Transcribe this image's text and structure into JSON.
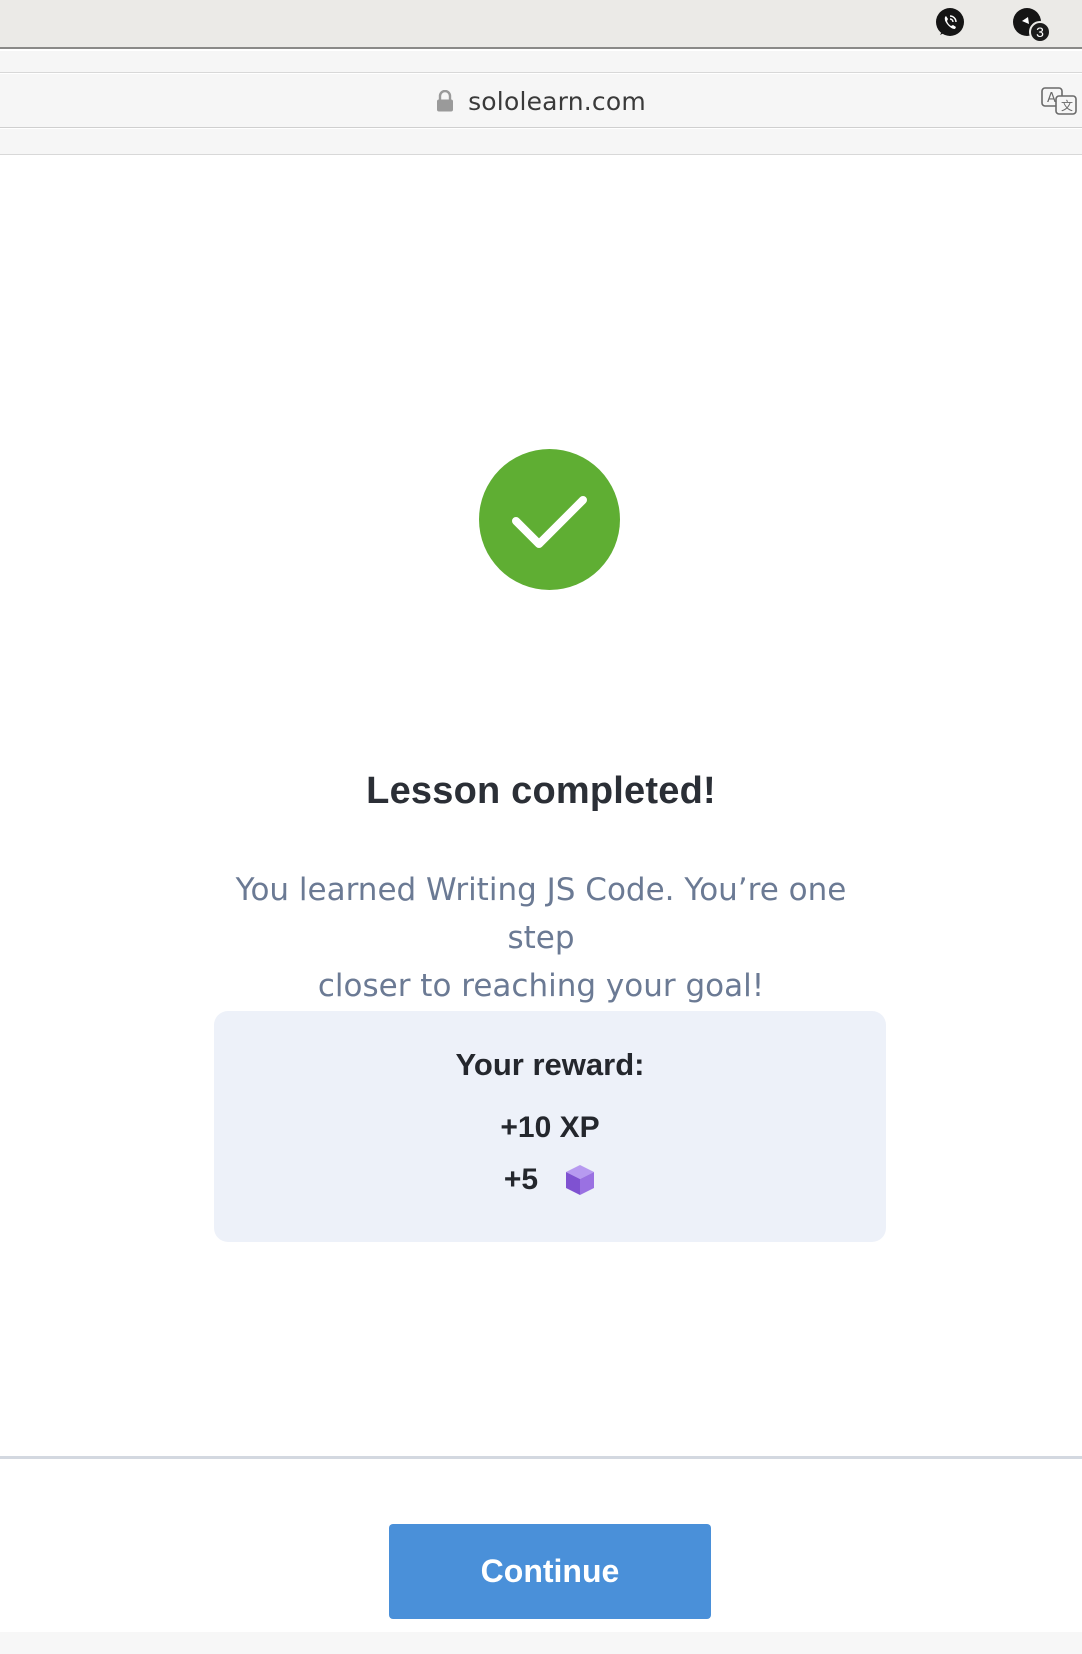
{
  "browser": {
    "url": "sololearn.com",
    "menubar_icons": [
      "viber-icon",
      "notification-bell-icon"
    ],
    "notification_count": "3"
  },
  "lesson": {
    "title": "Lesson completed!",
    "message_line1": "You learned Writing JS Code. You’re one step",
    "message_line2": "closer to reaching your goal!"
  },
  "reward": {
    "title": "Your reward:",
    "xp": "+10 XP",
    "bits": "+5",
    "bits_icon": "bit-cube-icon"
  },
  "actions": {
    "continue_label": "Continue"
  },
  "colors": {
    "success": "#5fae33",
    "primary_button": "#4a90d9",
    "reward_card": "#edf1f9",
    "cube": "#8a5cd6"
  }
}
